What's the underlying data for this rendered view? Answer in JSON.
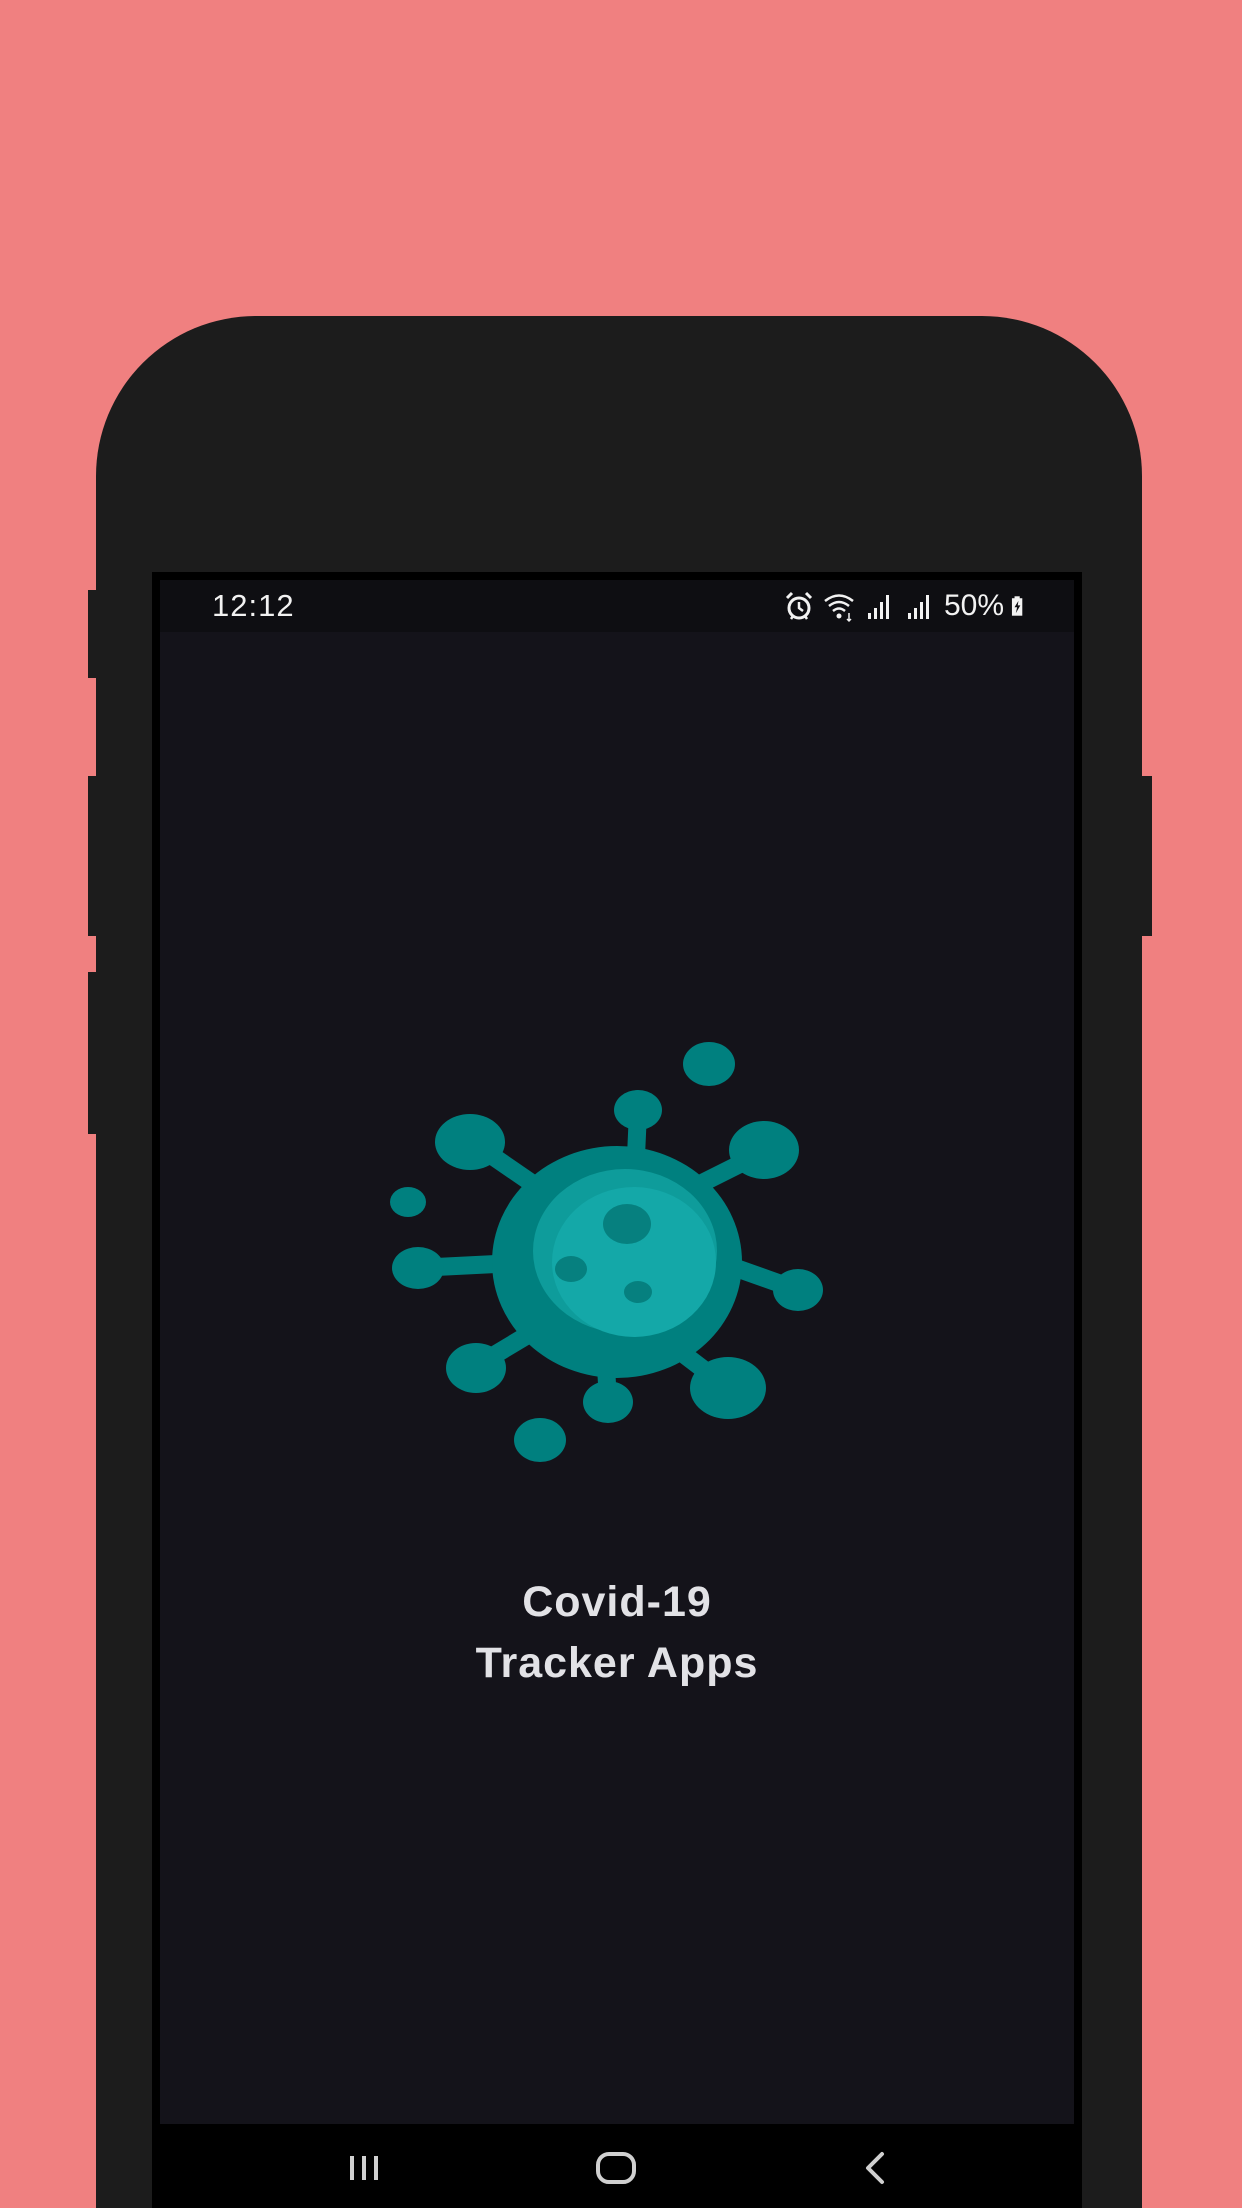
{
  "colors": {
    "background": "#f08080",
    "phone_frame": "#1c1c1c",
    "screen_background": "#14131a",
    "virus_primary": "#00807f",
    "virus_highlight": "#14a8a8",
    "title_text": "#e2e2e6"
  },
  "status_bar": {
    "time": "12:12",
    "battery_percent": "50%",
    "icons": [
      "alarm-icon",
      "wifi-icon",
      "signal-icon",
      "signal-icon",
      "battery-charging-icon"
    ]
  },
  "splash": {
    "logo_icon": "virus-icon",
    "title_line1": "Covid-19",
    "title_line2": "Tracker Apps"
  },
  "nav_bar": {
    "buttons": [
      "recent-apps-icon",
      "home-icon",
      "back-icon"
    ]
  }
}
